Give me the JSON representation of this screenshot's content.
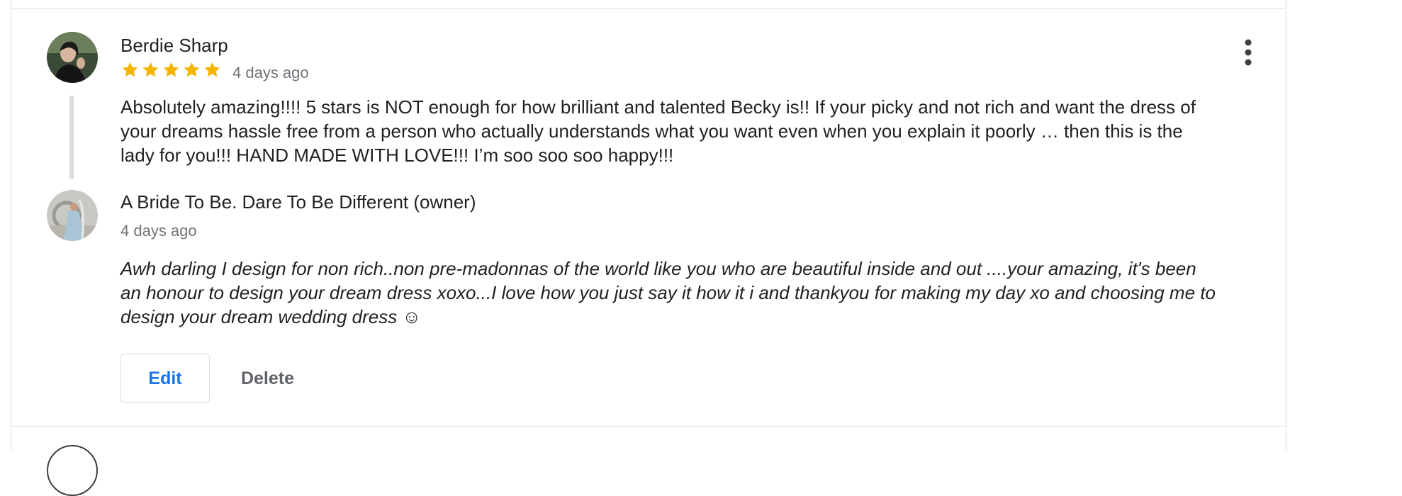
{
  "review": {
    "reviewer_name": "Berdie Sharp",
    "rating": 5,
    "rating_max": 5,
    "time": "4 days ago",
    "text": "Absolutely amazing!!!! 5 stars is NOT enough for how brilliant and talented Becky is!! If your picky and not rich and want the dress of your dreams hassle free from a person who actually understands what you want even when you explain it poorly … then this is the lady for you!!! HAND MADE WITH LOVE!!! I’m soo soo soo happy!!!",
    "star_color": "#f4b400",
    "more_icon": "more-vert-icon"
  },
  "owner_response": {
    "name": "A Bride To Be. Dare To Be Different (owner)",
    "time": "4 days ago",
    "text": "Awh darling I design for non rich..non pre-madonnas of the world like you who are beautiful inside and out ....your amazing, it's been an honour to design your dream dress xoxo...I love how you just say it how it i and thankyou for making my day xo and choosing me to design your dream wedding dress ☺"
  },
  "actions": {
    "edit_label": "Edit",
    "delete_label": "Delete"
  },
  "colors": {
    "accent": "#1a73e8",
    "text": "#202124",
    "secondary_text": "#70757a",
    "divider": "#dadce0"
  }
}
